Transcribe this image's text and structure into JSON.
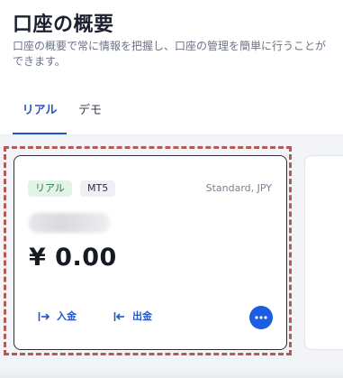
{
  "header": {
    "title": "口座の概要",
    "subtitle": "口座の概要で常に情報を把握し、口座の管理を簡単に行うことができます。"
  },
  "tabs": [
    {
      "label": "リアル",
      "active": true
    },
    {
      "label": "デモ",
      "active": false
    }
  ],
  "account_card": {
    "badges": {
      "type": "リアル",
      "platform": "MT5"
    },
    "account_type": "Standard, JPY",
    "balance": "¥ 0.00",
    "actions": {
      "deposit": "入金",
      "withdraw": "出金"
    },
    "more_icon": "more-horizontal-icon"
  },
  "colors": {
    "accent": "#2157c9",
    "more_button": "#1c5ce0",
    "badge_real_bg": "#e2f4e8",
    "badge_real_text": "#2f7a45",
    "dashed_highlight": "#b55a57",
    "content_bg": "#f3f4f7"
  }
}
